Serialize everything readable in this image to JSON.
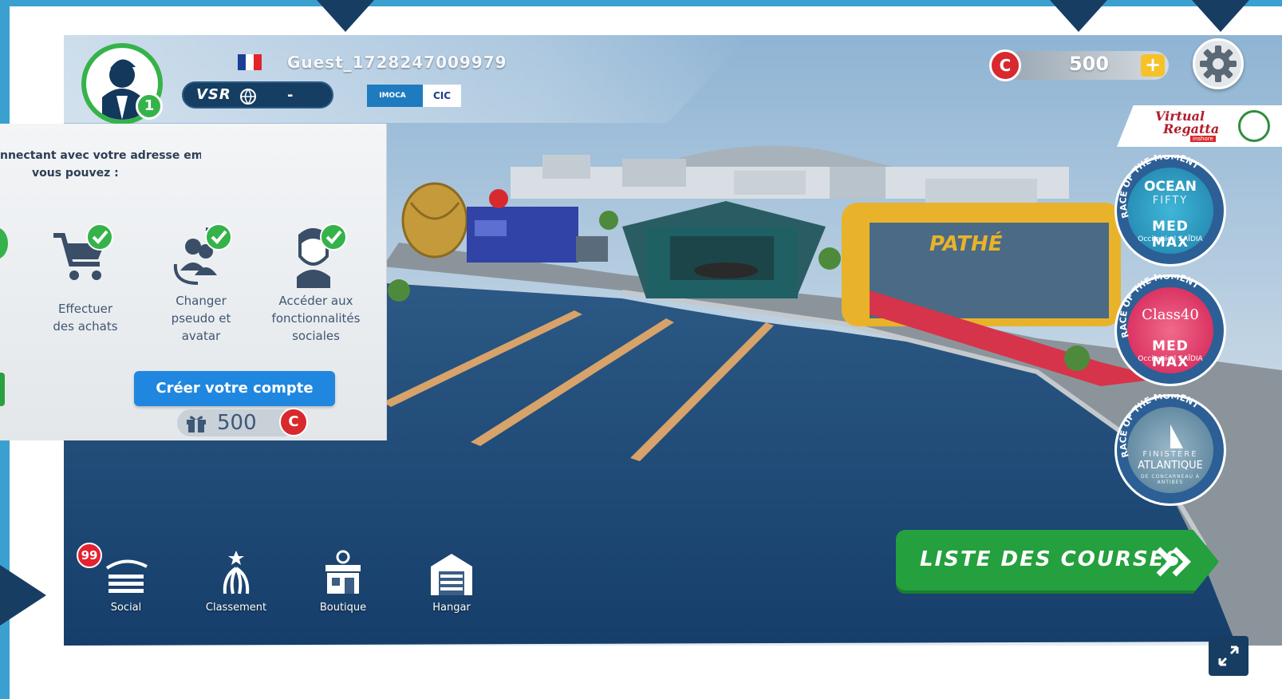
{
  "player": {
    "username": "Guest_1728247009979",
    "level": "1",
    "vsr_label": "VSR",
    "vsr_value": "-",
    "imoca_label": "IMOCA",
    "cic_label": "CIC"
  },
  "currency": {
    "symbol": "C",
    "balance": "500",
    "add_symbol": "+"
  },
  "brand": {
    "line1": "Virtual",
    "line2": "Regatta",
    "sub": "inshore"
  },
  "races": [
    {
      "ring_text": "RACE OF THE MOMENT",
      "name1": "OCEAN",
      "name2": "FIFTY",
      "medmax": "MED MAX",
      "occ": "Occitanie | SAÏDIA"
    },
    {
      "ring_text": "RACE OF THE MOMENT",
      "name1": "Class40",
      "medmax": "MED MAX",
      "occ": "Occitanie | SAÏDIA"
    },
    {
      "ring_text": "RACE OF THE MOMENT",
      "name1": "FINISTÈRE",
      "name2": "ATLANTIQUE",
      "small": "DE CONCARNEAU À ANTIBES"
    }
  ],
  "nav": {
    "social": "Social",
    "social_badge": "99",
    "classement": "Classement",
    "boutique": "Boutique",
    "hangar": "Hangar"
  },
  "courses_button": "LISTE DES COURSES",
  "panel": {
    "intro_line1": "nnectant avec votre adresse email,",
    "intro_line2": "vous pouvez :",
    "features": [
      {
        "line1": "Effectuer",
        "line2": "des achats"
      },
      {
        "line1": "Changer",
        "line2": "pseudo et",
        "line3": "avatar"
      },
      {
        "line1": "Accéder aux",
        "line2": "fonctionnalités",
        "line3": "sociales"
      }
    ],
    "create_button": "Créer votre compte",
    "reward_value": "500",
    "reward_symbol": "C"
  },
  "colors": {
    "accent_green": "#24a03e",
    "accent_blue": "#1f87e0",
    "coin_red": "#d8292e",
    "frame_blue": "#3aa0cf",
    "arrow_navy": "#173d63"
  }
}
